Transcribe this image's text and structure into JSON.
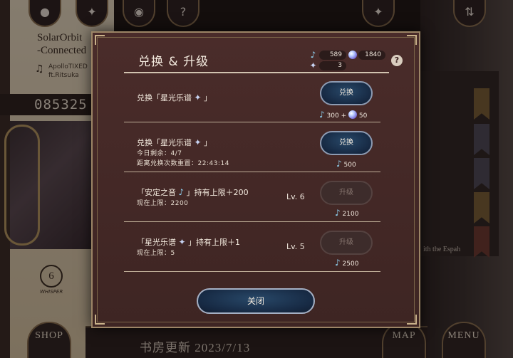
{
  "background": {
    "song_title": "SolarOrbit\n-Connected",
    "song_artist": "ApolloTIXED\nft.Ritsuka",
    "score": "085325",
    "whisper_count": "6",
    "whisper_label": "WHISPER",
    "side_text": "ith the Espah",
    "bottom_title": "书房更新 2023/7/13",
    "nav": {
      "shop_label": "SHOP",
      "map_label": "MAP",
      "menu_label": "MENU"
    }
  },
  "dialog": {
    "title": "兑换 & 升级",
    "resources": {
      "notes": "589",
      "orbs": "1840",
      "stars": "3"
    },
    "rows": [
      {
        "label": "兑换「星光乐谱",
        "label_end": "」",
        "button": "兑换",
        "cost_notes": "300",
        "cost_plus": "+",
        "cost_orbs": "50"
      },
      {
        "label": "兑换「星光乐谱",
        "label_end": "」",
        "remaining": "今日剩余：4/7",
        "reset": "距离兑换次数重置：22:43:14",
        "button": "兑换",
        "cost_notes": "500"
      },
      {
        "label": "「安定之音",
        "label_end": "」持有上限＋200",
        "current": "现在上限：2200",
        "level": "Lv. 6",
        "button": "升级",
        "cost_notes": "2100"
      },
      {
        "label": "「星光乐谱",
        "label_end": "」持有上限＋1",
        "current": "现在上限：5",
        "level": "Lv. 5",
        "button": "升级",
        "cost_notes": "2500"
      }
    ],
    "close_label": "关闭"
  },
  "icons": {
    "top_left": [
      "profile-icon",
      "sparkle-icon",
      "orb-icon",
      "help-icon"
    ],
    "top_right": [
      "sparkle-icon",
      "sort-icon"
    ]
  },
  "colors": {
    "dialog_bg": "#4a2c2a",
    "button_blue": "#172a44",
    "accent_note": "#8fd0ee"
  }
}
